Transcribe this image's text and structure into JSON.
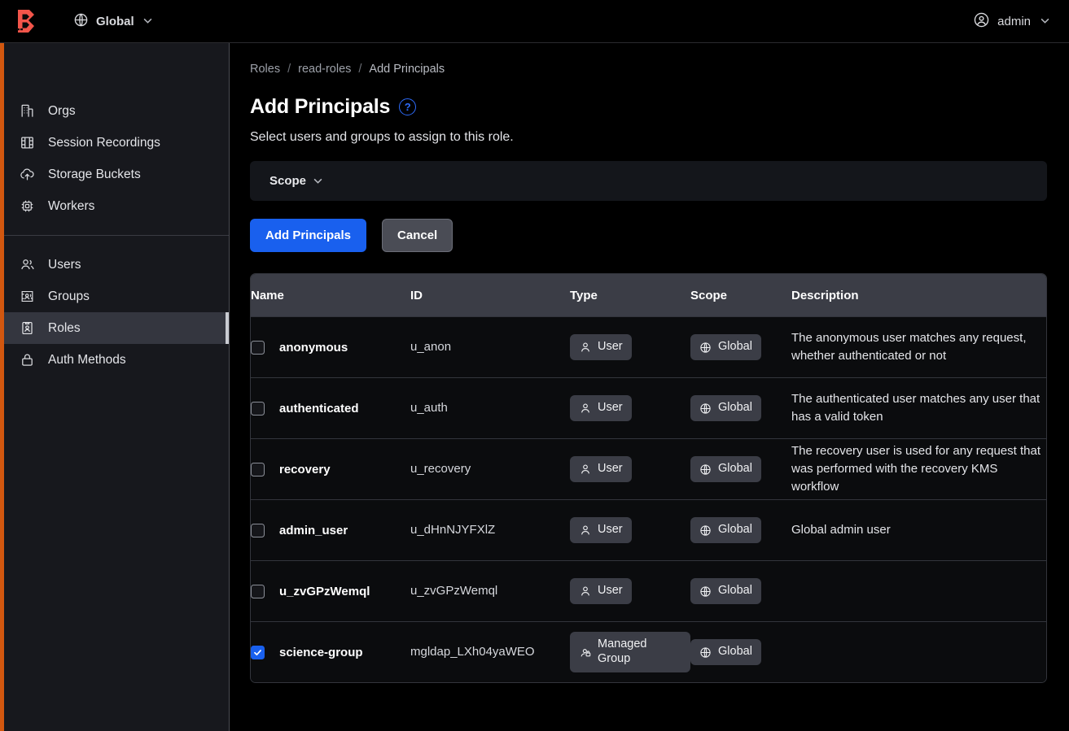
{
  "topbar": {
    "logo_name": "boundary-logo",
    "scope_switcher": {
      "icon": "globe-icon",
      "label": "Global",
      "chevron": "⌄"
    },
    "user_menu": {
      "icon": "user-circle-icon",
      "label": "admin",
      "chevron": "⌄"
    }
  },
  "sidebar": {
    "group_one": [
      {
        "icon": "orgs-icon",
        "label": "Orgs"
      },
      {
        "icon": "session-recordings-icon",
        "label": "Session Recordings"
      },
      {
        "icon": "storage-buckets-icon",
        "label": "Storage Buckets"
      },
      {
        "icon": "workers-icon",
        "label": "Workers"
      }
    ],
    "group_two": [
      {
        "icon": "users-icon",
        "label": "Users",
        "active": false
      },
      {
        "icon": "groups-icon",
        "label": "Groups",
        "active": false
      },
      {
        "icon": "roles-icon",
        "label": "Roles",
        "active": true
      },
      {
        "icon": "auth-methods-icon",
        "label": "Auth Methods",
        "active": false
      }
    ]
  },
  "breadcrumb": {
    "items": [
      "Roles",
      "read-roles",
      "Add Principals"
    ],
    "separator": "/"
  },
  "page": {
    "title": "Add Principals",
    "help_icon_label": "?",
    "subtitle": "Select users and groups to assign to this role."
  },
  "filter": {
    "scope_label": "Scope",
    "chevron": "⌄"
  },
  "actions": {
    "primary_label": "Add Principals",
    "secondary_label": "Cancel"
  },
  "table": {
    "headers": [
      "Name",
      "ID",
      "Type",
      "Scope",
      "Description"
    ],
    "rows": [
      {
        "checked": false,
        "name": "anonymous",
        "id": "u_anon",
        "type": "User",
        "type_icon": "user-icon",
        "scope": "Global",
        "scope_icon": "globe-icon",
        "description": "The anonymous user matches any request, whether authenticated or not"
      },
      {
        "checked": false,
        "name": "authenticated",
        "id": "u_auth",
        "type": "User",
        "type_icon": "user-icon",
        "scope": "Global",
        "scope_icon": "globe-icon",
        "description": "The authenticated user matches any user that has a valid token"
      },
      {
        "checked": false,
        "name": "recovery",
        "id": "u_recovery",
        "type": "User",
        "type_icon": "user-icon",
        "scope": "Global",
        "scope_icon": "globe-icon",
        "description": "The recovery user is used for any request that was performed with the recovery KMS workflow"
      },
      {
        "checked": false,
        "name": "admin_user",
        "id": "u_dHnNJYFXlZ",
        "type": "User",
        "type_icon": "user-icon",
        "scope": "Global",
        "scope_icon": "globe-icon",
        "description": "Global admin user"
      },
      {
        "checked": false,
        "name": "u_zvGPzWemql",
        "id": "u_zvGPzWemql",
        "type": "User",
        "type_icon": "user-icon",
        "scope": "Global",
        "scope_icon": "globe-icon",
        "description": ""
      },
      {
        "checked": true,
        "name": "science-group",
        "id": "mgldap_LXh04yaWEO",
        "type": "Managed Group",
        "type_icon": "managed-group-icon",
        "scope": "Global",
        "scope_icon": "globe-icon",
        "description": ""
      }
    ]
  },
  "colors": {
    "accent_blue": "#1960ee",
    "help_blue": "#2d6bfa",
    "logo_red": "#f2554a",
    "edge_orange": "#d2570f",
    "sidebar_bg": "#17181d",
    "header_row_bg": "#3b3d46"
  }
}
